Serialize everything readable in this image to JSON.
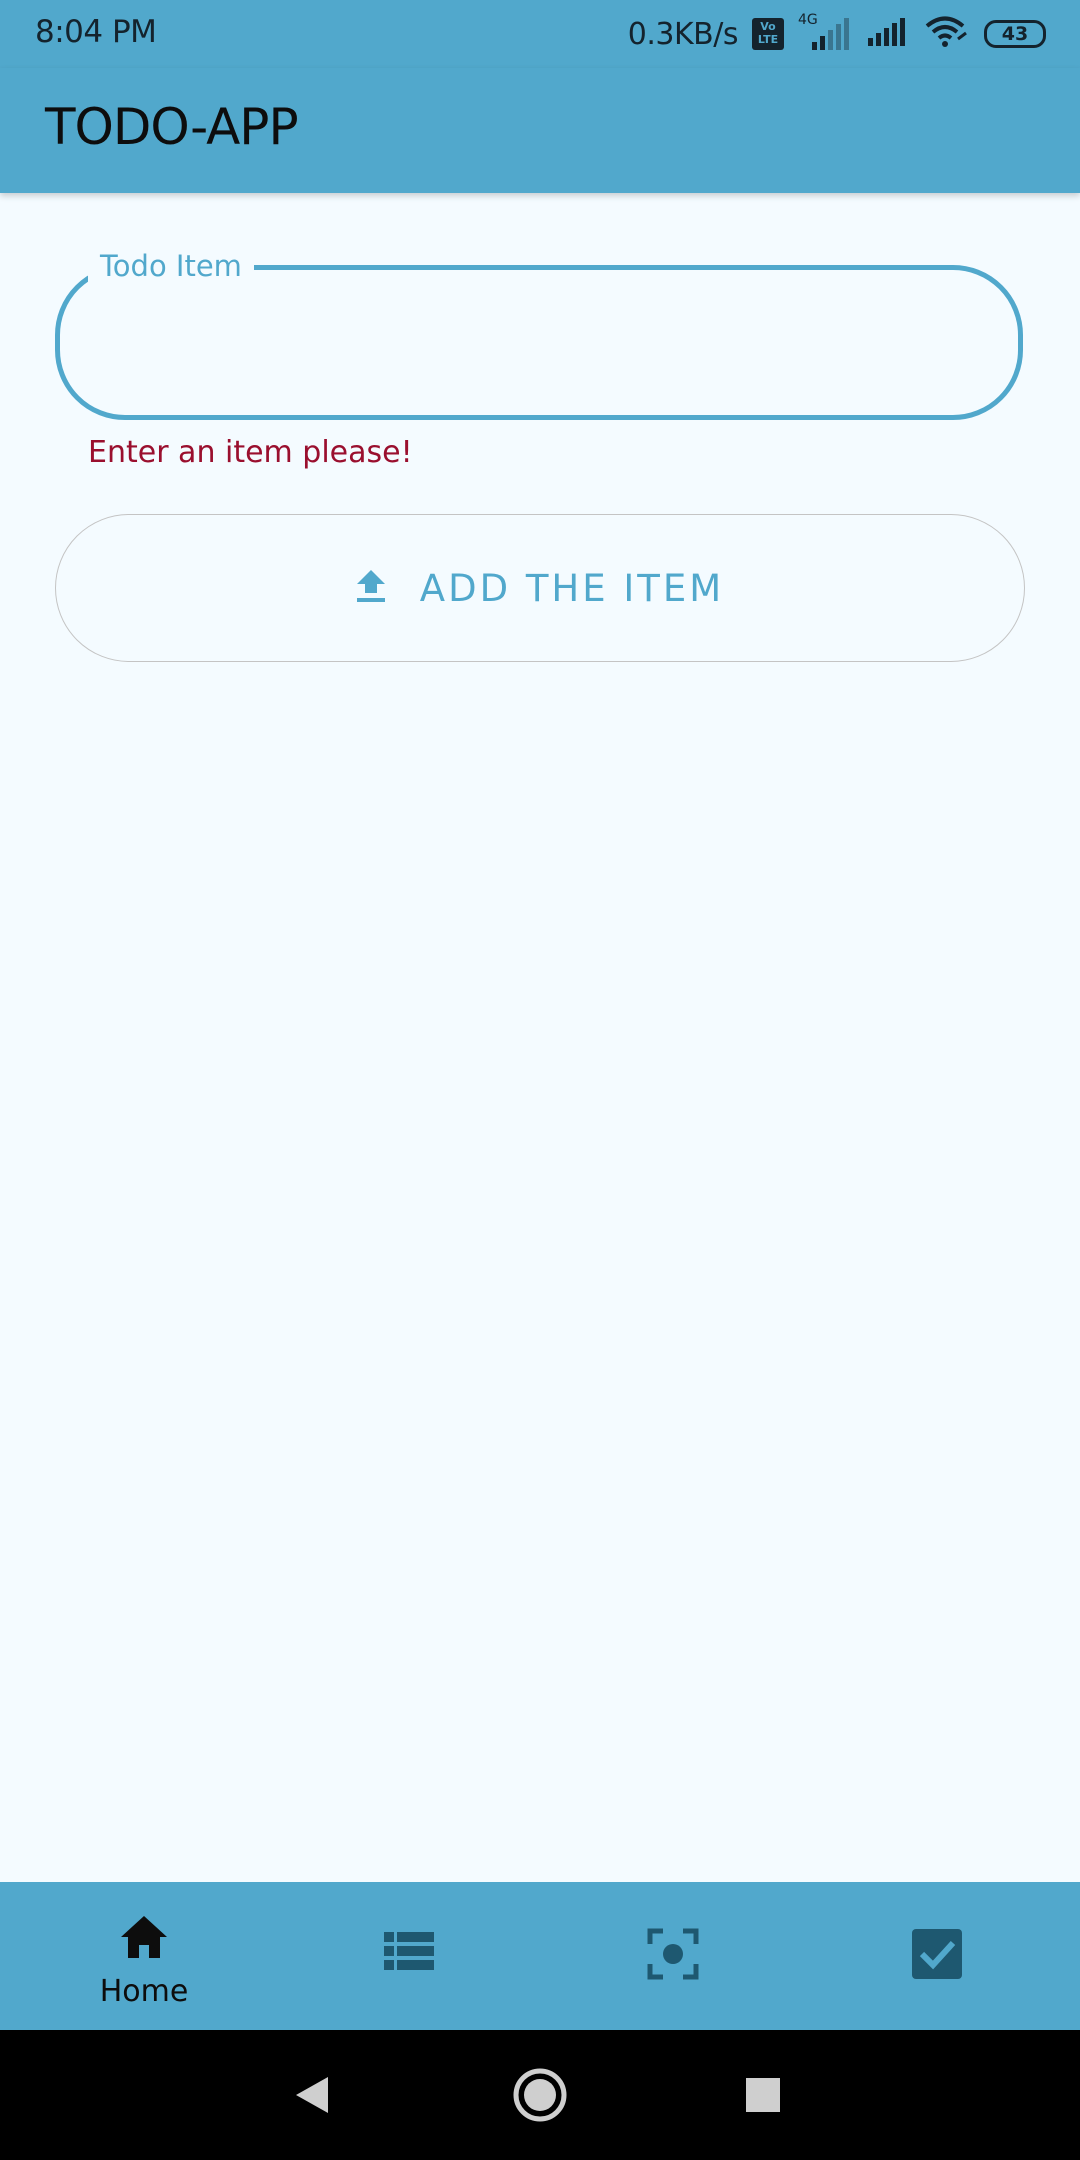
{
  "status_bar": {
    "time": "8:04 PM",
    "net_speed": "0.3KB/s",
    "volte": "Vo LTE",
    "network_type": "4G",
    "battery": "43"
  },
  "app_bar": {
    "title": "TODO-APP"
  },
  "form": {
    "field_label": "Todo Item",
    "field_value": "",
    "error_text": "Enter an item please!",
    "add_button_label": "ADD THE ITEM",
    "add_button_icon": "upload-icon"
  },
  "bottom_nav": {
    "items": [
      {
        "icon": "home-icon",
        "label": "Home",
        "active": true
      },
      {
        "icon": "list-icon",
        "label": "",
        "active": false
      },
      {
        "icon": "focus-icon",
        "label": "",
        "active": false
      },
      {
        "icon": "checkbox-icon",
        "label": "",
        "active": false
      }
    ]
  },
  "system_nav": {
    "buttons": [
      "back-icon",
      "home-circle-icon",
      "recents-icon"
    ]
  },
  "colors": {
    "primary": "#51a8cc",
    "background": "#f4fbff",
    "error": "#9a0f2e",
    "nav_icon_inactive": "#1e5870"
  }
}
